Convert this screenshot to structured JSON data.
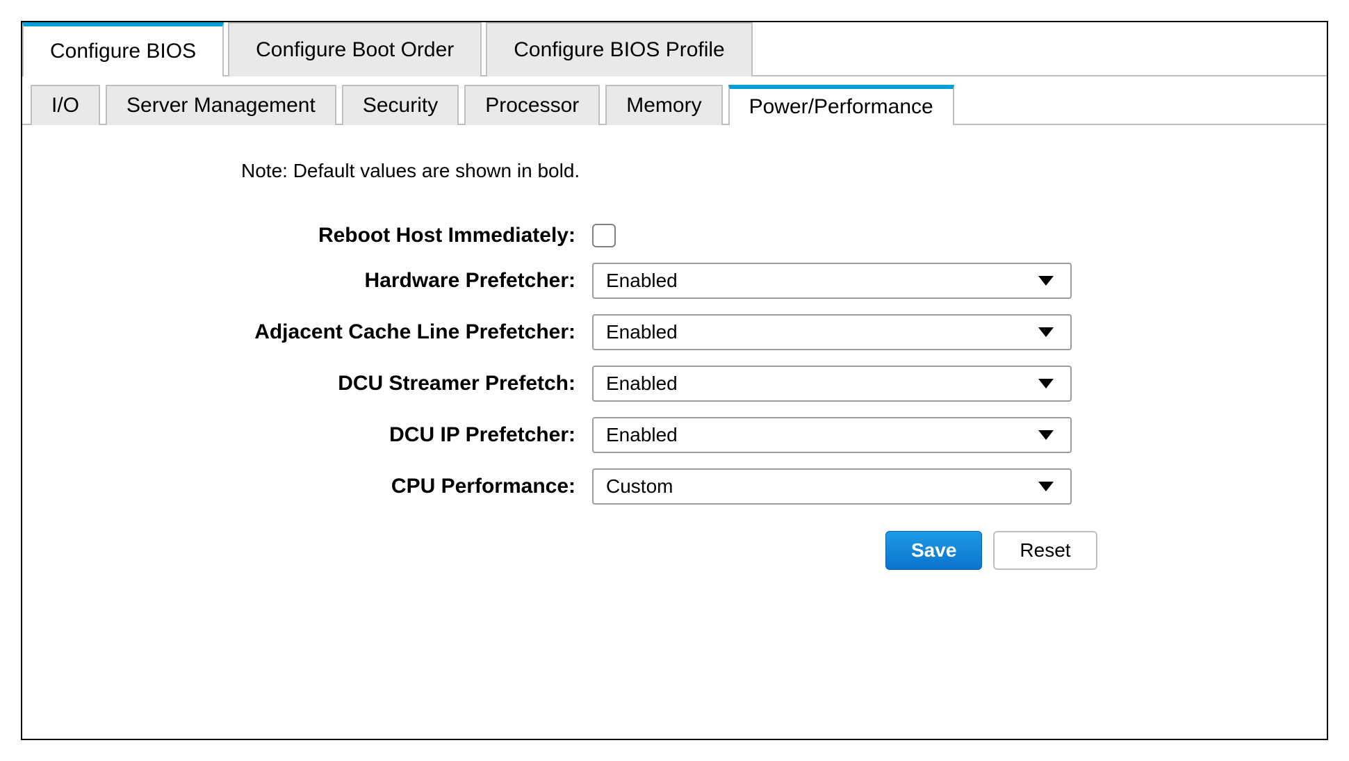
{
  "primary_tabs": {
    "items": [
      {
        "label": "Configure BIOS"
      },
      {
        "label": "Configure Boot Order"
      },
      {
        "label": "Configure BIOS Profile"
      }
    ],
    "active_index": 0
  },
  "secondary_tabs": {
    "items": [
      {
        "label": "I/O"
      },
      {
        "label": "Server Management"
      },
      {
        "label": "Security"
      },
      {
        "label": "Processor"
      },
      {
        "label": "Memory"
      },
      {
        "label": "Power/Performance"
      }
    ],
    "active_index": 5
  },
  "note_text": "Note: Default values are shown in bold.",
  "form": {
    "reboot_label": "Reboot Host Immediately:",
    "reboot_checked": false,
    "hardware_prefetcher": {
      "label": "Hardware Prefetcher:",
      "value": "Enabled"
    },
    "adjacent_cache_prefetcher": {
      "label": "Adjacent Cache Line Prefetcher:",
      "value": "Enabled"
    },
    "dcu_streamer_prefetch": {
      "label": "DCU Streamer Prefetch:",
      "value": "Enabled"
    },
    "dcu_ip_prefetcher": {
      "label": "DCU IP Prefetcher:",
      "value": "Enabled"
    },
    "cpu_performance": {
      "label": "CPU Performance:",
      "value": "Custom"
    }
  },
  "buttons": {
    "save": "Save",
    "reset": "Reset"
  }
}
